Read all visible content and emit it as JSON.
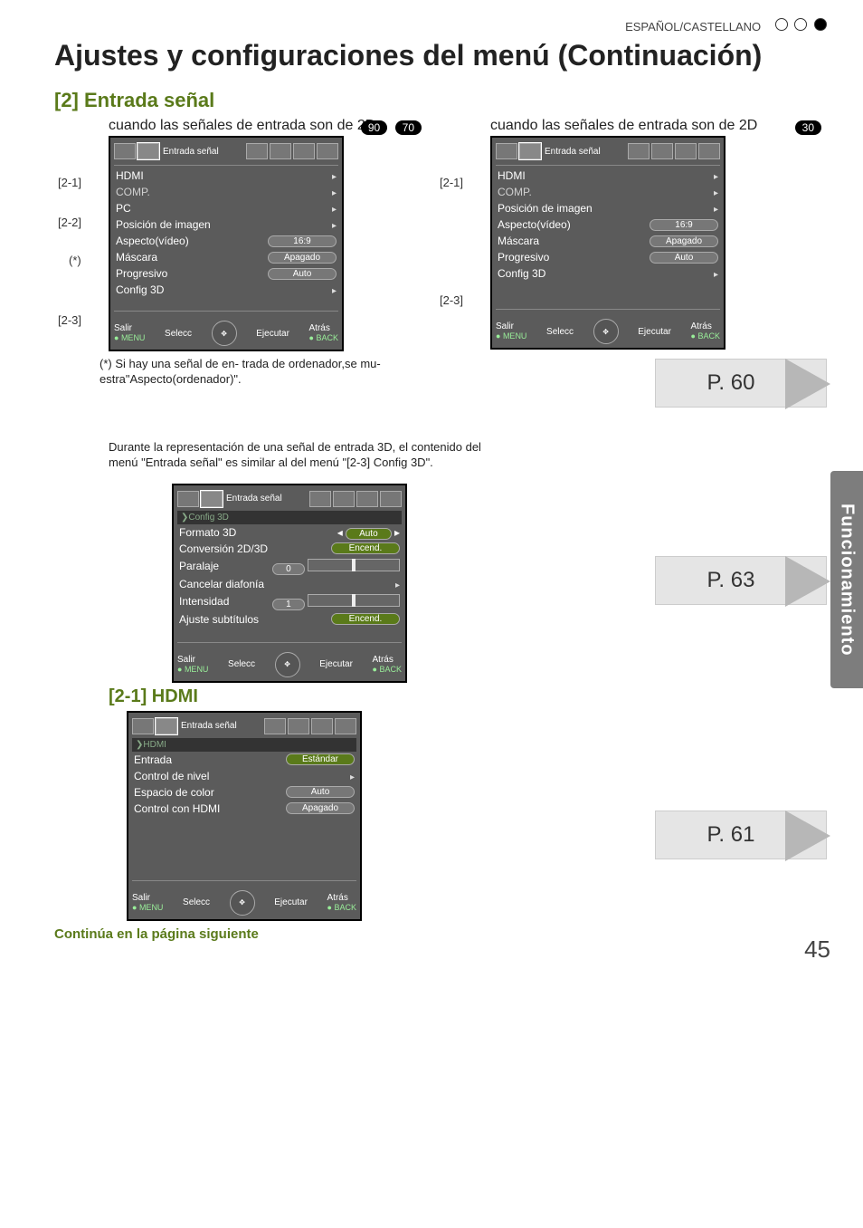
{
  "header": {
    "language": "ESPAÑOL/CASTELLANO"
  },
  "title": "Ajustes y configuraciones del menú (Continuación)",
  "section": "[2] Entrada señal",
  "signal_caption": "cuando las señales de entrada son de 2D",
  "badges_left": [
    "90",
    "70"
  ],
  "badges_right": [
    "30"
  ],
  "panel_tabname": "Entrada señal",
  "panel_items": {
    "hdmi": "HDMI",
    "comp": "COMP.",
    "pc": "PC",
    "pos": "Posición de imagen",
    "aspect": "Aspecto(vídeo)",
    "aspect_val": "16:9",
    "mask": "Máscara",
    "mask_val": "Apagado",
    "prog": "Progresivo",
    "prog_val": "Auto",
    "c3d": "Config 3D"
  },
  "footer": {
    "salir": "Salir",
    "menu": "MENU",
    "selecc": "Selecc",
    "ejecutar": "Ejecutar",
    "atras": "Atrás",
    "back": "BACK"
  },
  "refs": {
    "r21": "[2-1]",
    "r22": "[2-2]",
    "star": "(*)",
    "r23": "[2-3]"
  },
  "note_asterisk": "(*) Si hay una señal de en- trada de ordenador,se mu- estra\"Aspecto(ordenador)\".",
  "note_3d": "Durante la representación de una señal de entrada 3D, el contenido del menú \"Entrada señal\" es similar al del menú \"[2-3] Config 3D\".",
  "panel_3d": {
    "breadcrumb": "Config 3D",
    "formato": "Formato 3D",
    "formato_val": "Auto",
    "conv": "Conversión 2D/3D",
    "conv_val": "Encend.",
    "paralaje": "Paralaje",
    "paralaje_val": "0",
    "cancel": "Cancelar diafonía",
    "intensidad": "Intensidad",
    "intensidad_val": "1",
    "ajuste": "Ajuste subtítulos",
    "ajuste_val": "Encend."
  },
  "sub_hdmi_title": "[2-1] HDMI",
  "panel_hdmi": {
    "breadcrumb": "HDMI",
    "entrada": "Entrada",
    "entrada_val": "Estándar",
    "nivel": "Control de nivel",
    "espacio": "Espacio de color",
    "espacio_val": "Auto",
    "control": "Control con HDMI",
    "control_val": "Apagado"
  },
  "pagelinks": {
    "p60": "P. 60",
    "p63": "P. 63",
    "p61": "P. 61"
  },
  "side_tab": "Funcionamiento",
  "continue_text": "Continúa en la página siguiente",
  "page_number": "45"
}
